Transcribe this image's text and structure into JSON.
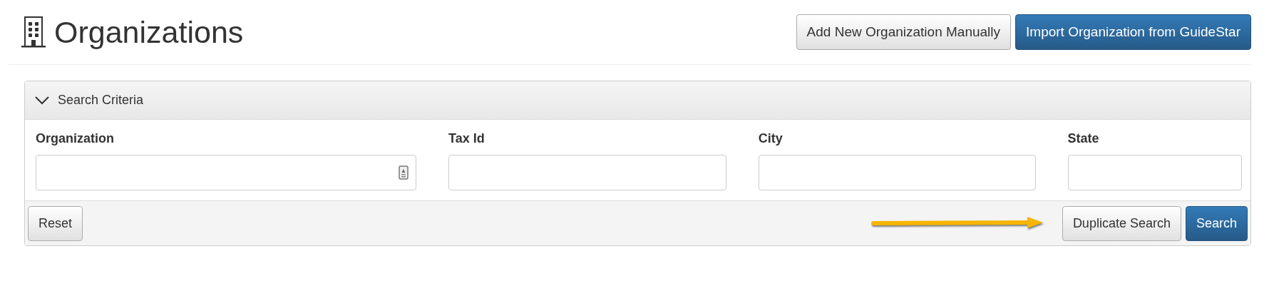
{
  "header": {
    "title": "Organizations",
    "actions": [
      {
        "label": "Add New Organization Manually",
        "kind": "default"
      },
      {
        "label": "Import Organization from GuideStar",
        "kind": "primary"
      }
    ]
  },
  "search_panel": {
    "title": "Search Criteria",
    "expanded": true,
    "fields": [
      {
        "label": "Organization",
        "lookup": true
      },
      {
        "label": "Tax Id",
        "lookup": false
      },
      {
        "label": "City",
        "lookup": false
      },
      {
        "label": "State",
        "lookup": false
      }
    ],
    "footer": {
      "left": [
        {
          "label": "Reset",
          "kind": "default"
        }
      ],
      "right": [
        {
          "label": "Duplicate Search",
          "kind": "default",
          "pointer": true
        },
        {
          "label": "Search",
          "kind": "primary",
          "pointer": false
        }
      ]
    }
  }
}
